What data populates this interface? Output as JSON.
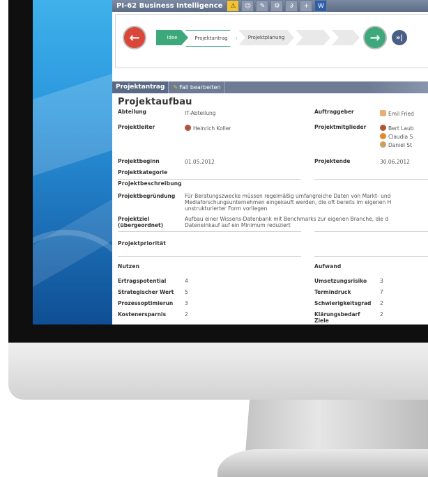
{
  "app": {
    "title": "PI-62 Business Intelligence",
    "toolbar_icons": [
      "warning-icon",
      "users-icon",
      "edit-icon",
      "settings-icon",
      "link-icon",
      "add-document-icon",
      "word-icon"
    ]
  },
  "process": {
    "steps": [
      "Idee",
      "Projektantrag",
      "Projektplanung",
      "",
      ""
    ],
    "current_step": "Projektantrag"
  },
  "section": {
    "tab": "Projektantrag",
    "edit_label": "Fall bearbeiten"
  },
  "projektaufbau": {
    "heading": "Projektaufbau",
    "abteilung_label": "Abteilung",
    "abteilung_value": "IT-Abteilung",
    "auftraggeber_label": "Auftraggeber",
    "auftraggeber_value": "Emil Fried",
    "projektleiter_label": "Projektleiter",
    "projektleiter_value": "Heinrich Koller",
    "projektmitglieder_label": "Projektmitglieder",
    "projektmitglieder": [
      "Bert Laub",
      "Claudia S",
      "Daniel St"
    ],
    "projektbeginn_label": "Projektbeginn",
    "projektbeginn_value": "01.05.2012",
    "projektende_label": "Projektende",
    "projektende_value": "30.06.2012",
    "projektkategorie_label": "Projektkategorie"
  },
  "beschreibung": {
    "heading": "Projektbeschreibung",
    "begruendung_label": "Projektbegründung",
    "begruendung_lines": [
      "Für Beratungszwecke müssen regelmäßig umfangreiche Daten von Markt- und",
      "Mediaforschungsunternehmen eingekauft werden, die oft bereits im eigenen H",
      "unstrukturierter Form vorliegen"
    ],
    "ziel_label_1": "Projektziel",
    "ziel_label_2": "(übergeordnet)",
    "ziel_lines": [
      "Aufbau einer Wissens-Datenbank mit Benchmarks zur eigenen Branche, die d",
      "Dateneinkauf auf ein Minimum reduziert"
    ]
  },
  "prioritaet": {
    "heading": "Projektpriorität"
  },
  "nutzen": {
    "heading": "Nutzen",
    "items": [
      {
        "label": "Ertragspotential",
        "value": "4"
      },
      {
        "label": "Strategischer Wert",
        "value": "5"
      },
      {
        "label": "Prozessoptimierun",
        "value": "3"
      },
      {
        "label": "Kostenersparnis",
        "value": "2"
      }
    ]
  },
  "aufwand": {
    "heading": "Aufwand",
    "items": [
      {
        "label": "Umsetzungsrisiko",
        "value": "3"
      },
      {
        "label": "Termindruck",
        "value": "7"
      },
      {
        "label": "Schwierigkeitsgrad",
        "value": "2"
      },
      {
        "label": "Klärungsbedarf",
        "value": "2"
      }
    ],
    "extra_label": "Ziele"
  },
  "colors": {
    "titlebar": "#5d6c86",
    "accent_green": "#3da87a",
    "accent_red": "#d9463a",
    "navy": "#4a5f85"
  }
}
